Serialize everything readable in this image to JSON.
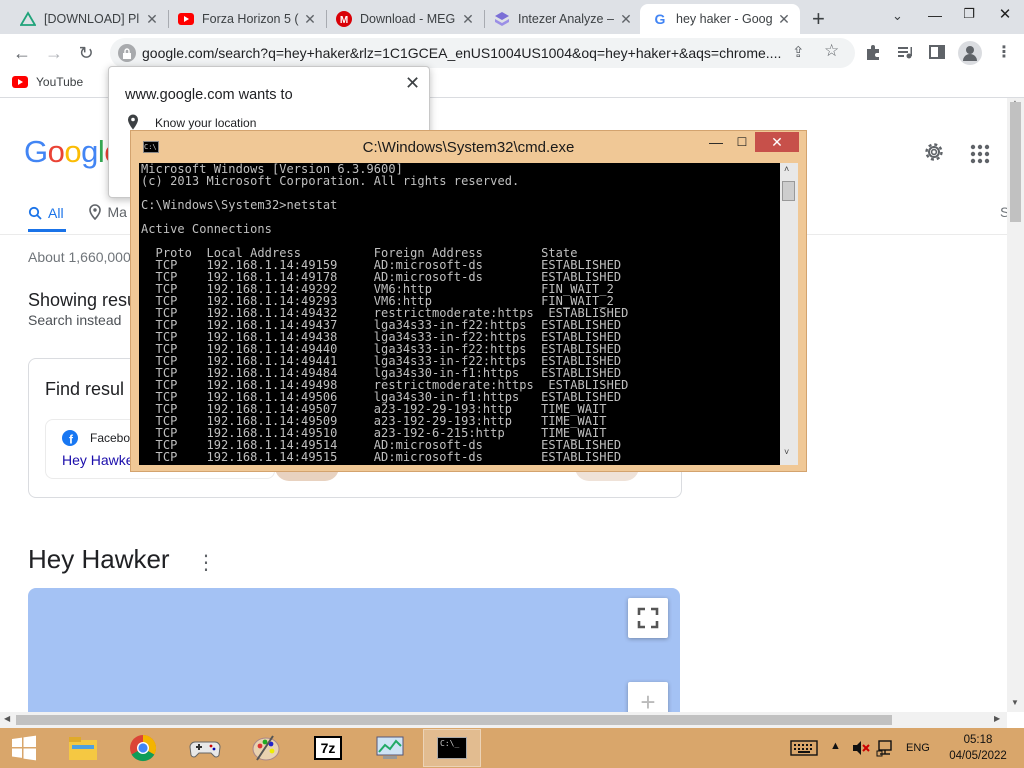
{
  "browser": {
    "tabs": [
      {
        "label": "[DOWNLOAD] Pl",
        "icon": "triangle-icon"
      },
      {
        "label": "Forza Horizon 5 (",
        "icon": "youtube-icon"
      },
      {
        "label": "Download - MEG",
        "icon": "mega-icon"
      },
      {
        "label": "Intezer Analyze –",
        "icon": "intezer-icon"
      },
      {
        "label": "hey haker - Goog",
        "icon": "google-icon",
        "active": true
      }
    ],
    "url": "google.com/search?q=hey+haker&rlz=1C1GCEA_enUS1004US1004&oq=hey+haker+&aqs=chrome....",
    "bookmarks": [
      {
        "label": "YouTube"
      }
    ]
  },
  "location_popup": {
    "title": "www.google.com wants to",
    "permission": "Know your location"
  },
  "google": {
    "logo": "Google",
    "tabs": {
      "all": "All",
      "maps": "Ma",
      "right": "S"
    },
    "result_stats": "About 1,660,000",
    "showing": "Showing resu",
    "search_instead": "Search instead",
    "find_results": "Find resul",
    "facebook_label": "Facebo",
    "facebook_link": "Hey Hawke",
    "section_title": "Hey Hawker"
  },
  "cmd": {
    "title": "C:\\Windows\\System32\\cmd.exe",
    "lines": [
      "Microsoft Windows [Version 6.3.9600]",
      "(c) 2013 Microsoft Corporation. All rights reserved.",
      "",
      "C:\\Windows\\System32>netstat",
      "",
      "Active Connections",
      "",
      "  Proto  Local Address          Foreign Address        State",
      "  TCP    192.168.1.14:49159     AD:microsoft-ds        ESTABLISHED",
      "  TCP    192.168.1.14:49178     AD:microsoft-ds        ESTABLISHED",
      "  TCP    192.168.1.14:49292     VM6:http               FIN_WAIT_2",
      "  TCP    192.168.1.14:49293     VM6:http               FIN_WAIT_2",
      "  TCP    192.168.1.14:49432     restrictmoderate:https  ESTABLISHED",
      "  TCP    192.168.1.14:49437     lga34s33-in-f22:https  ESTABLISHED",
      "  TCP    192.168.1.14:49438     lga34s33-in-f22:https  ESTABLISHED",
      "  TCP    192.168.1.14:49440     lga34s33-in-f22:https  ESTABLISHED",
      "  TCP    192.168.1.14:49441     lga34s33-in-f22:https  ESTABLISHED",
      "  TCP    192.168.1.14:49484     lga34s30-in-f1:https   ESTABLISHED",
      "  TCP    192.168.1.14:49498     restrictmoderate:https  ESTABLISHED",
      "  TCP    192.168.1.14:49506     lga34s30-in-f1:https   ESTABLISHED",
      "  TCP    192.168.1.14:49507     a23-192-29-193:http    TIME_WAIT",
      "  TCP    192.168.1.14:49509     a23-192-29-193:http    TIME_WAIT",
      "  TCP    192.168.1.14:49510     a23-192-6-215:http     TIME_WAIT",
      "  TCP    192.168.1.14:49514     AD:microsoft-ds        ESTABLISHED",
      "  TCP    192.168.1.14:49515     AD:microsoft-ds        ESTABLISHED"
    ]
  },
  "taskbar": {
    "apps": [
      "file-explorer-icon",
      "chrome-icon",
      "game-controller-icon",
      "paint-icon",
      "7zip-icon",
      "control-panel-icon",
      "cmd-icon"
    ],
    "seven_zip_label": "7z",
    "language": "ENG",
    "time": "05:18",
    "date": "04/05/2022"
  }
}
